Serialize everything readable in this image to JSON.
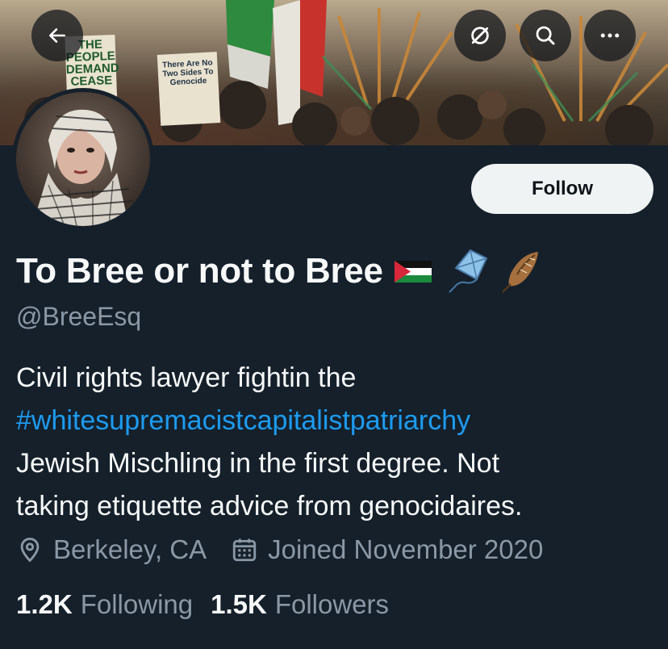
{
  "banner": {
    "sign_left": [
      "THE PEOPLE",
      "DEMAND",
      "CEASE"
    ],
    "sign_right": [
      "There Are No",
      "Two Sides To",
      "Genocide"
    ]
  },
  "header": {
    "back_icon": "arrow-left-icon",
    "hide_icon": "eye-slash-icon",
    "search_icon": "search-icon",
    "more_icon": "more-horizontal-icon"
  },
  "profile": {
    "display_name": "To Bree or not to Bree",
    "name_emojis": [
      "🇵🇸",
      "🪁",
      "🪶"
    ],
    "handle": "@BreeEsq",
    "follow_label": "Follow",
    "bio": {
      "line1": "Civil rights lawyer fightin the",
      "hashtag": "#whitesupremacistcapitalistpatriarchy",
      "line3": "Jewish Mischling in the first degree. Not",
      "line4": "taking etiquette advice from genocidaires."
    },
    "location": "Berkeley, CA",
    "joined": "Joined November 2020",
    "following_count": "1.2K",
    "following_label": "Following",
    "followers_count": "1.5K",
    "followers_label": "Followers"
  },
  "colors": {
    "background": "#15202b",
    "text": "#f7f9f9",
    "secondary": "#8b98a5",
    "link": "#1d9bf0",
    "button_bg": "#eff3f4"
  }
}
